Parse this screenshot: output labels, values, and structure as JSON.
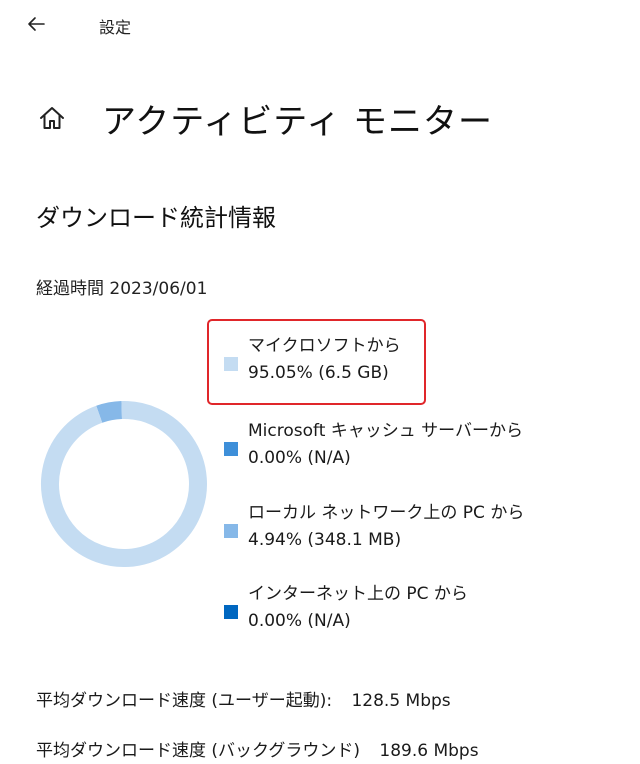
{
  "window": {
    "title": "設定"
  },
  "header": {
    "page_title": "アクティビティ モニター"
  },
  "section": {
    "title": "ダウンロード統計情報",
    "elapsed": "経過時間 2023/06/01"
  },
  "colors": {
    "microsoft": "#c4dcf2",
    "ms_cache": "#3e8fd9",
    "lan_pc": "#86b8e8",
    "internet_pc": "#0067c0",
    "highlight": "#e0262a"
  },
  "legend": [
    {
      "name": "マイクロソフトから",
      "value": "95.05%  (6.5 GB)"
    },
    {
      "name": "Microsoft キャッシュ サーバーから",
      "value": "0.00%  (N/A)"
    },
    {
      "name": "ローカル ネットワーク上の PC から",
      "value": "4.94%  (348.1 MB)"
    },
    {
      "name": "インターネット上の PC から",
      "value": "0.00%  (N/A)"
    }
  ],
  "donut_percentages": [
    95.05,
    0.0,
    4.94,
    0.0
  ],
  "stats": [
    {
      "label": "平均ダウンロード速度 (ユーザー起動):",
      "value": "128.5 Mbps"
    },
    {
      "label": "平均ダウンロード速度 (バックグラウンド)",
      "value": "189.6 Mbps"
    }
  ]
}
